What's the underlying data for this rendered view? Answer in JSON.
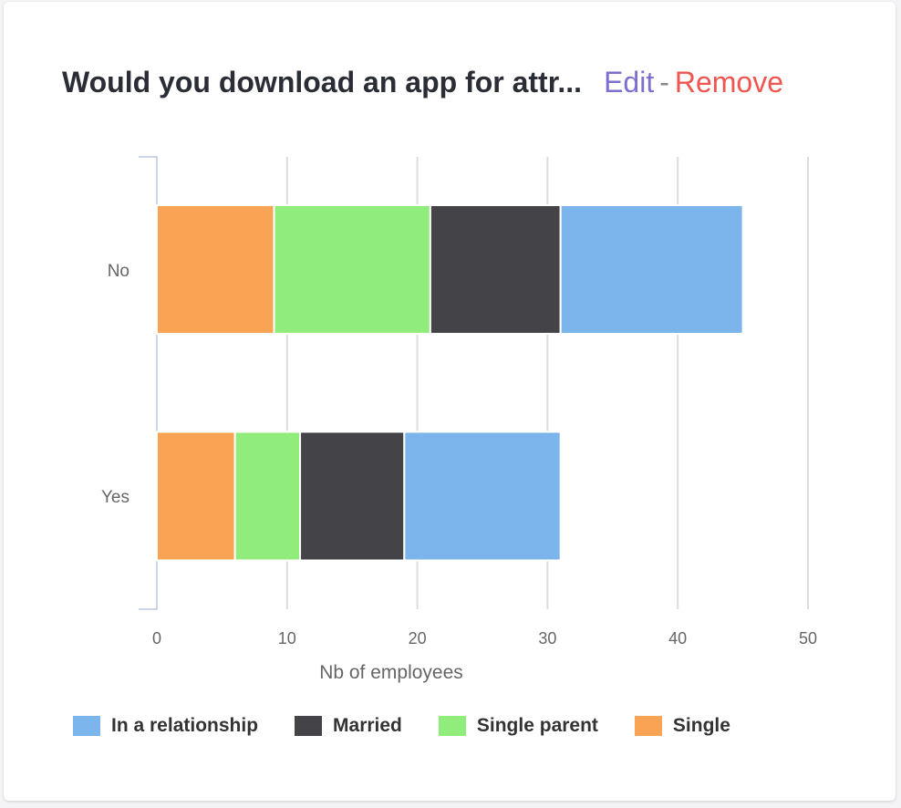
{
  "header": {
    "title": "Would you download an app for attr...",
    "edit": "Edit",
    "separator": "-",
    "remove": "Remove"
  },
  "chart_data": {
    "type": "bar",
    "orientation": "horizontal",
    "stacked": true,
    "categories": [
      "No",
      "Yes"
    ],
    "series": [
      {
        "name": "Single",
        "color": "#f9a455",
        "values": [
          9,
          6
        ]
      },
      {
        "name": "Single parent",
        "color": "#90ed7b",
        "values": [
          12,
          5
        ]
      },
      {
        "name": "Married",
        "color": "#434348",
        "values": [
          10,
          8
        ]
      },
      {
        "name": "In a relationship",
        "color": "#7cb5ec",
        "values": [
          14,
          12
        ]
      }
    ],
    "legend_order": [
      "In a relationship",
      "Married",
      "Single parent",
      "Single"
    ],
    "xlabel": "Nb of employees",
    "xlim": [
      0,
      50
    ],
    "xticks": [
      "0",
      "10",
      "20",
      "30",
      "40",
      "50"
    ],
    "grid": true,
    "legend_position": "bottom"
  }
}
